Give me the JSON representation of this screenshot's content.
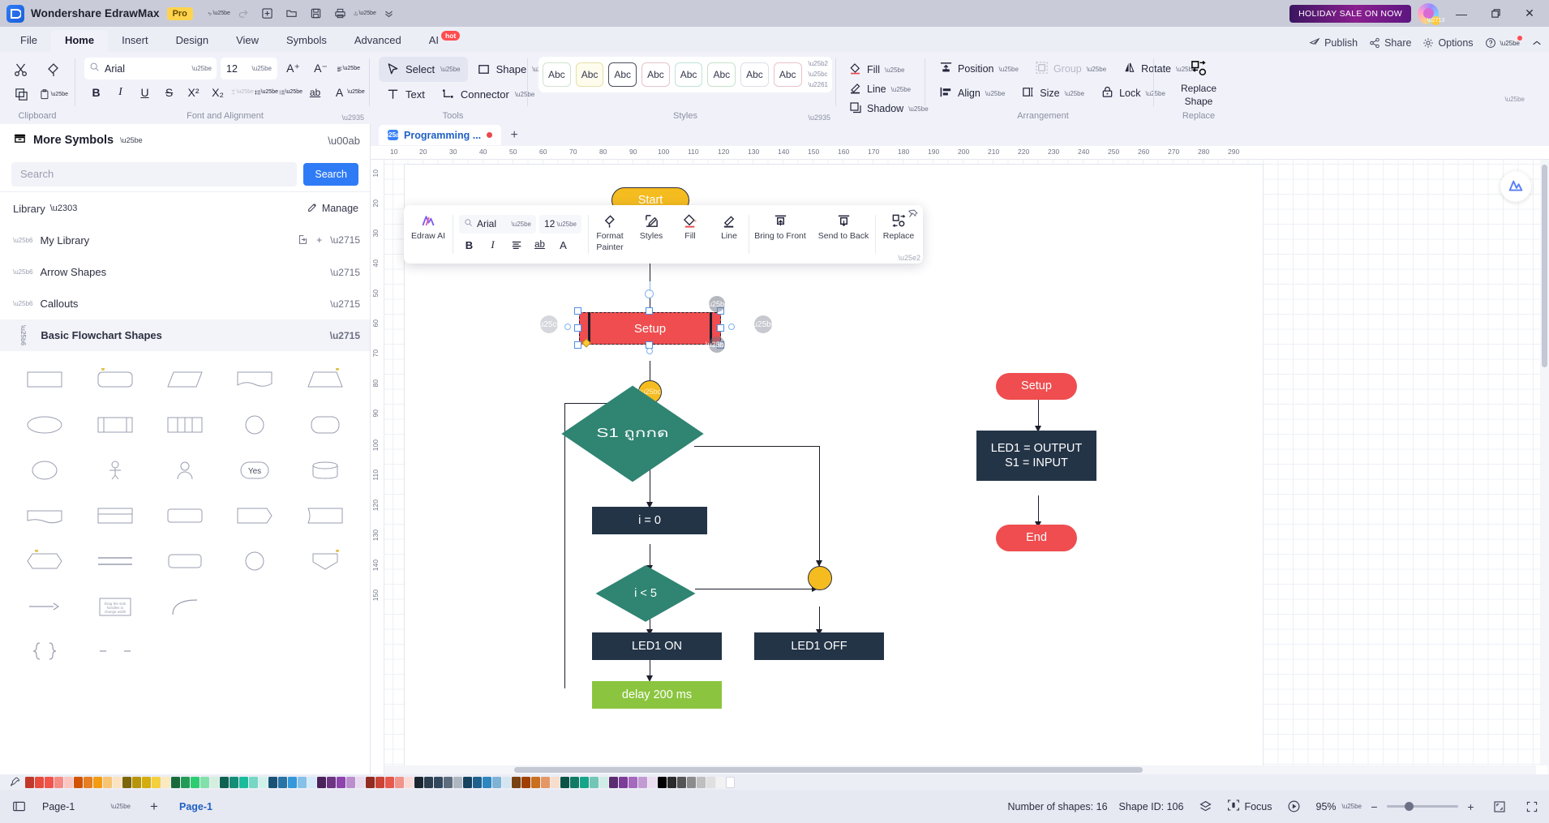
{
  "titlebar": {
    "app_name": "Wondershare EdrawMax",
    "pro_badge": "Pro",
    "quick_icons": [
      "undo-icon",
      "redo-icon",
      "new-icon",
      "open-icon",
      "save-icon",
      "print-icon",
      "export-icon",
      "more-chevron-icon"
    ],
    "promo": "HOLIDAY SALE ON NOW",
    "minimize": "—",
    "maximize": "❐",
    "close": "✕"
  },
  "menubar": {
    "tabs": [
      {
        "label": "File",
        "active": false
      },
      {
        "label": "Home",
        "active": true
      },
      {
        "label": "Insert",
        "active": false
      },
      {
        "label": "Design",
        "active": false
      },
      {
        "label": "View",
        "active": false
      },
      {
        "label": "Symbols",
        "active": false
      },
      {
        "label": "Advanced",
        "active": false
      },
      {
        "label": "AI",
        "active": false,
        "badge": "hot"
      }
    ],
    "right": [
      {
        "label": "Publish",
        "icon": "publish-icon"
      },
      {
        "label": "Share",
        "icon": "share-icon"
      },
      {
        "label": "Options",
        "icon": "gear-icon"
      },
      {
        "label": "",
        "icon": "help-icon"
      }
    ]
  },
  "ribbon": {
    "groups": [
      {
        "name": "Clipboard",
        "label": "Clipboard"
      },
      {
        "name": "Font and Alignment",
        "label": "Font and Alignment"
      },
      {
        "name": "Tools",
        "label": "Tools"
      },
      {
        "name": "Styles",
        "label": "Styles"
      },
      {
        "name": "Arrangement",
        "label": "Arrangement"
      },
      {
        "name": "Replace",
        "label": "Replace"
      }
    ],
    "font": {
      "family": "Arial",
      "size": "12",
      "bold": "B",
      "italic": "I",
      "underline": "U",
      "strike": "S",
      "superscript": "X²",
      "subscript": "X₂",
      "text_effect": "T",
      "line_spacing": "line-spacing-icon",
      "bullets": "bullets-icon",
      "ab": "ab",
      "font_color": "A",
      "grow_font": "A⁺",
      "shrink_font": "A⁻",
      "align": "align-icon"
    },
    "tools": {
      "select": "Select",
      "shape": "Shape",
      "text": "Text",
      "connector": "Connector"
    },
    "styles": {
      "swatch_label": "Abc",
      "swatch_count": 8
    },
    "fill_line": {
      "fill": "Fill",
      "line": "Line",
      "shadow": "Shadow"
    },
    "arrangement": {
      "position": "Position",
      "group": "Group",
      "rotate": "Rotate",
      "align": "Align",
      "size": "Size",
      "lock": "Lock"
    },
    "replace": {
      "line1": "Replace",
      "line2": "Shape"
    }
  },
  "sidebar": {
    "title": "More Symbols",
    "search_placeholder": "Search",
    "search_button": "Search",
    "library_label": "Library",
    "manage_label": "Manage",
    "categories": [
      {
        "label": "My Library",
        "open": false,
        "actions": [
          "import-icon",
          "add-icon",
          "close-icon"
        ]
      },
      {
        "label": "Arrow Shapes",
        "open": false,
        "actions": [
          "close-icon"
        ]
      },
      {
        "label": "Callouts",
        "open": false,
        "actions": [
          "close-icon"
        ]
      },
      {
        "label": "Basic Flowchart Shapes",
        "open": true,
        "actions": [
          "close-icon"
        ]
      }
    ],
    "shape_palette_rows": 5
  },
  "canvas": {
    "document_tab": "Programming ...",
    "add_tab": "+",
    "h_ruler_ticks": [
      "10",
      "20",
      "30",
      "40",
      "50",
      "60",
      "70",
      "80",
      "90",
      "100",
      "110",
      "120",
      "130",
      "140",
      "150",
      "160",
      "170",
      "180",
      "190",
      "200",
      "210",
      "220",
      "230",
      "240",
      "250",
      "260",
      "270",
      "280",
      "290"
    ],
    "v_ruler_ticks": [
      "10",
      "20",
      "30",
      "40",
      "50",
      "60",
      "70",
      "80",
      "90",
      "100",
      "110",
      "120",
      "130",
      "140",
      "150"
    ],
    "shapes": [
      {
        "id": "start",
        "label": "Start",
        "type": "terminator",
        "color": "#f5bc20"
      },
      {
        "id": "setup-selected",
        "label": "Setup",
        "type": "process-selected",
        "color": "#ef4d4f"
      },
      {
        "id": "connector-1",
        "label": "",
        "type": "connector",
        "color": "#f5bc20"
      },
      {
        "id": "decision-1",
        "label": "S1 ถูกกด",
        "type": "decision",
        "color": "#2f8472"
      },
      {
        "id": "process-i0",
        "label": "i = 0",
        "type": "process",
        "color": "#243447"
      },
      {
        "id": "decision-2",
        "label": "i < 5",
        "type": "decision",
        "color": "#2f8472"
      },
      {
        "id": "connector-2",
        "label": "",
        "type": "connector",
        "color": "#f5bc20"
      },
      {
        "id": "led1-on",
        "label": "LED1 ON",
        "type": "process",
        "color": "#243447"
      },
      {
        "id": "led1-off",
        "label": "LED1 OFF",
        "type": "process",
        "color": "#243447"
      },
      {
        "id": "delay-200",
        "label": "delay 200 ms",
        "type": "process",
        "color": "#8bc53f"
      },
      {
        "id": "side-setup",
        "label": "Setup",
        "type": "terminator",
        "color": "#ef4d4f"
      },
      {
        "id": "side-io",
        "label": "LED1 = OUTPUT\nS1 = INPUT",
        "line1": "LED1 = OUTPUT",
        "line2": "S1 = INPUT",
        "type": "process",
        "color": "#243447"
      },
      {
        "id": "side-end",
        "label": "End",
        "type": "terminator",
        "color": "#ef4d4f"
      }
    ]
  },
  "floating_toolbar": {
    "edraw_ai": "Edraw AI",
    "font_family": "Arial",
    "font_size": "12",
    "bold": "B",
    "italic": "I",
    "align": "align-icon",
    "ab": "ab",
    "font_color": "A",
    "format_painter_l1": "Format",
    "format_painter_l2": "Painter",
    "styles": "Styles",
    "fill": "Fill",
    "line": "Line",
    "bring_front_l1": "Bring to Front",
    "send_back_l1": "Send to Back",
    "replace": "Replace"
  },
  "statusbar": {
    "page_select_value": "Page-1",
    "add_page": "+",
    "page_tab": "Page-1",
    "shapes_count": "Number of shapes: 16",
    "shape_id": "Shape ID: 106",
    "focus": "Focus",
    "zoom": "95%",
    "zoom_out": "−",
    "zoom_in": "+"
  },
  "colors": {
    "accent": "#2f7bf6",
    "selected_shape": "#ef4d4f",
    "decision": "#2f8472",
    "process": "#243447",
    "terminator_yellow": "#f5bc20",
    "green": "#8bc53f",
    "tab_blue": "#1f60c4"
  }
}
